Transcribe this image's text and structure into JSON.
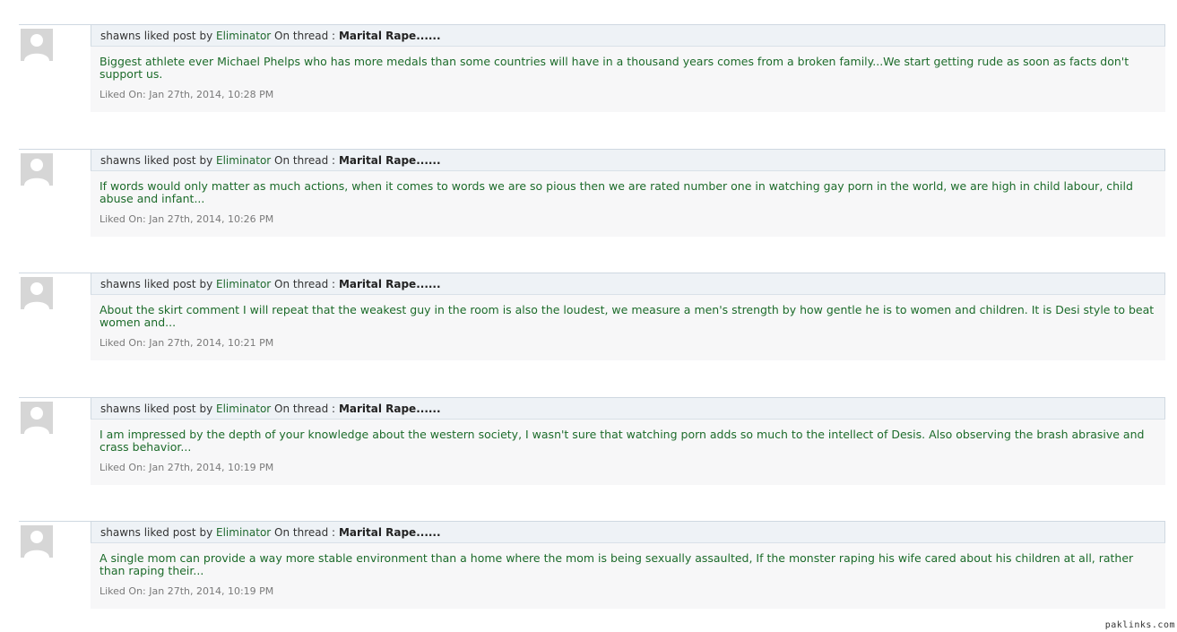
{
  "labels": {
    "liked_post_by": "liked post by",
    "on_thread": "On thread :",
    "liked_on": "Liked On:"
  },
  "entries": [
    {
      "user": "shawns",
      "author": "Eliminator",
      "thread": "Marital Rape......",
      "excerpt": "Biggest athlete ever Michael Phelps who has more medals than some countries will have in a thousand years comes from a broken family...We start getting rude as soon as facts don't support us.",
      "date": "Jan 27th, 2014, 10:28 PM"
    },
    {
      "user": "shawns",
      "author": "Eliminator",
      "thread": "Marital Rape......",
      "excerpt": "If words would only matter as much actions, when it comes to words we are so pious then we are rated number one in watching gay porn in the world, we are high in child labour, child abuse and infant...",
      "date": "Jan 27th, 2014, 10:26 PM"
    },
    {
      "user": "shawns",
      "author": "Eliminator",
      "thread": "Marital Rape......",
      "excerpt": "About the skirt comment I will repeat that the weakest guy in the room is also the loudest, we measure a men's strength by how gentle he is to women and children. It is Desi style to beat women and...",
      "date": "Jan 27th, 2014, 10:21 PM"
    },
    {
      "user": "shawns",
      "author": "Eliminator",
      "thread": "Marital Rape......",
      "excerpt": "I am impressed by the depth of your knowledge about the western society, I wasn't sure that watching porn adds so much to the intellect of Desis. Also observing the brash abrasive and crass behavior...",
      "date": "Jan 27th, 2014, 10:19 PM"
    },
    {
      "user": "shawns",
      "author": "Eliminator",
      "thread": "Marital Rape......",
      "excerpt": "A single mom can provide a way more stable environment than a home where the mom is being sexually assaulted, If the monster raping his wife cared about his children at all, rather than raping their...",
      "date": "Jan 27th, 2014, 10:19 PM"
    }
  ],
  "watermark": "paklinks.com",
  "colors": {
    "link_green": "#206a2e",
    "excerpt_green": "#1c6b2a",
    "header_bg": "#eef2f6",
    "card_bg": "#f7f7f8"
  }
}
